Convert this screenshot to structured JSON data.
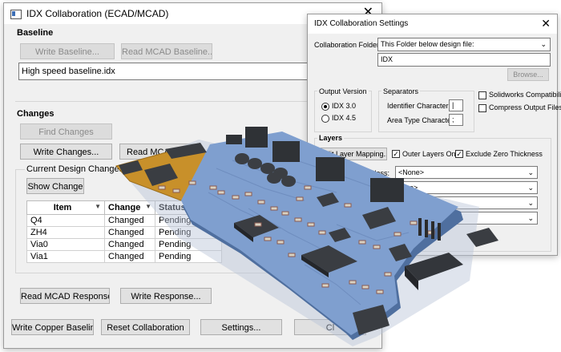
{
  "main_window": {
    "title": "IDX Collaboration (ECAD/MCAD)",
    "baseline": {
      "heading": "Baseline",
      "write_baseline": "Write Baseline...",
      "read_mcad_baseline": "Read MCAD Baseline...",
      "baseline_file": "High speed baseline.idx"
    },
    "changes": {
      "heading": "Changes",
      "find_changes": "Find Changes",
      "write_changes": "Write Changes...",
      "read_mcad": "Read MCAD",
      "current_design_changes": "Current Design Changes",
      "show_change": "Show Change",
      "columns": [
        "Item",
        "Change",
        "Status"
      ],
      "rows": [
        {
          "item": "Q4",
          "change": "Changed",
          "status": "Pending"
        },
        {
          "item": "ZH4",
          "change": "Changed",
          "status": "Pending"
        },
        {
          "item": "Via0",
          "change": "Changed",
          "status": "Pending"
        },
        {
          "item": "Via1",
          "change": "Changed",
          "status": "Pending"
        }
      ]
    },
    "read_mcad_response": "Read MCAD Response...",
    "write_response": "Write Response...",
    "write_copper_baseline": "Write Copper Baseline",
    "reset_collaboration": "Reset Collaboration",
    "settings": "Settings...",
    "close": "Cl"
  },
  "settings_window": {
    "title": "IDX Collaboration Settings",
    "collaboration_folder_label": "Collaboration Folder:",
    "collaboration_folder_value": "This Folder below design file:",
    "folder_name": "IDX",
    "browse": "Browse...",
    "output_version": {
      "heading": "Output Version",
      "idx30": "IDX 3.0",
      "idx45": "IDX 4.5",
      "selected": "IDX 3.0"
    },
    "separators": {
      "heading": "Separators",
      "identifier_label": "Identifier Character:",
      "identifier_value": "|",
      "area_type_label": "Area Type Character:",
      "area_type_value": ";"
    },
    "solidworks_compat": "Solidworks Compatibility",
    "compress_output": "Compress Output Files",
    "layers": {
      "heading": "Layers",
      "edit_layer_mapping": "Edit Layer Mapping...",
      "outer_layers_only": "Outer Layers Only",
      "exclude_zero_thickness": "Exclude Zero Thickness",
      "layer_class_label": "Layer Class:",
      "layer_class_value": "<None>",
      "combo2_value": "e>",
      "combo3_value": "reen",
      "combo4_value": ""
    }
  },
  "colors": {
    "pcb_blue": "#7f9fcf",
    "pcb_edge": "#5d7fb5",
    "flex_orange": "#c8902a",
    "chip_dark": "#3a3d42"
  }
}
